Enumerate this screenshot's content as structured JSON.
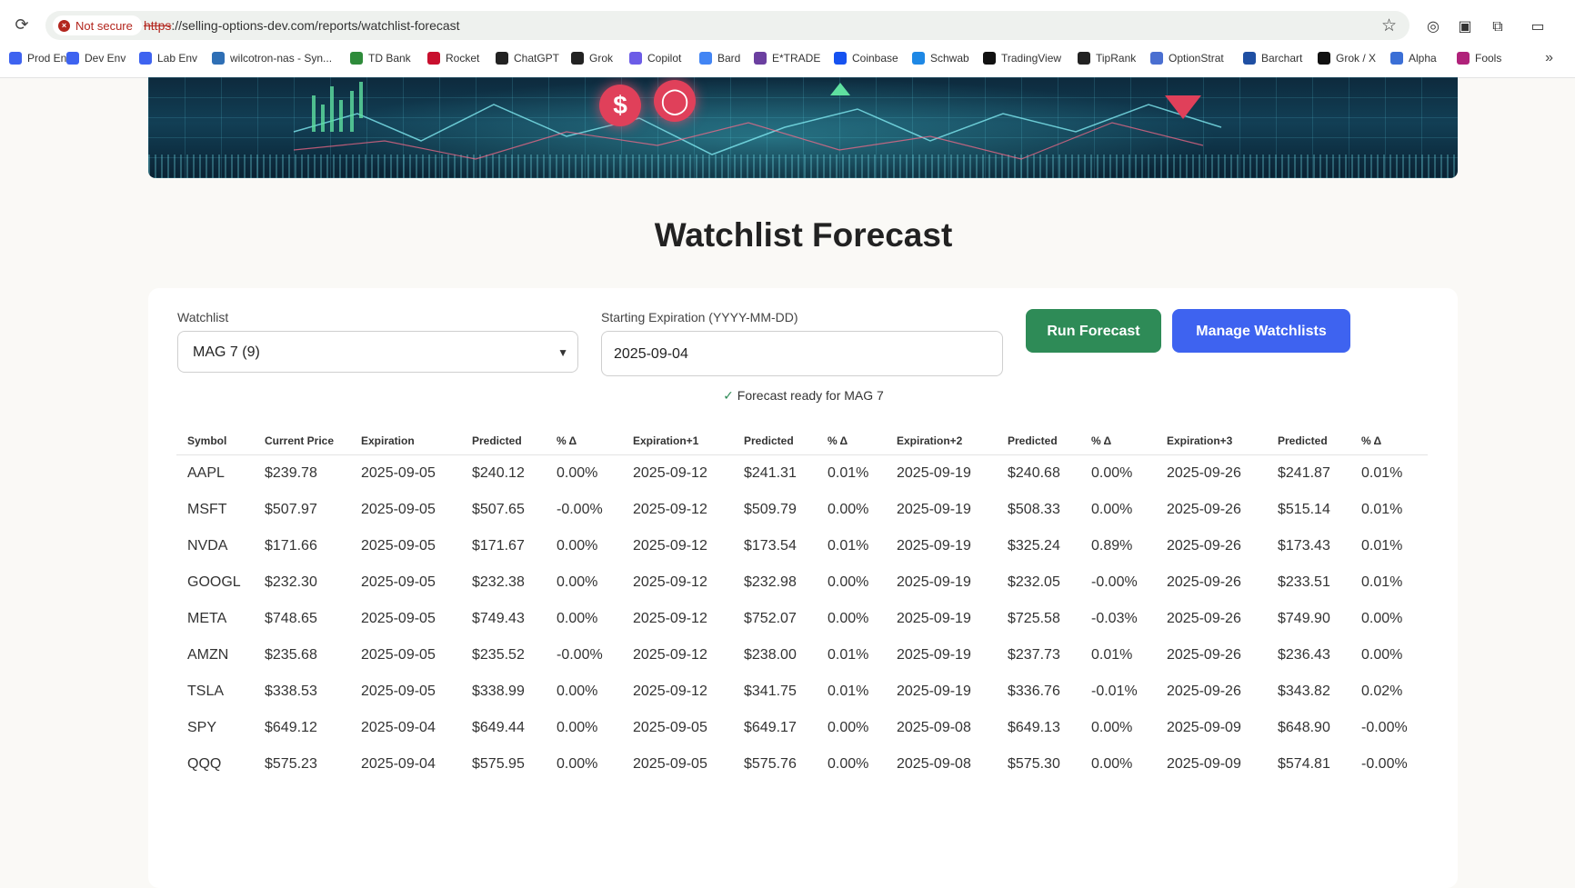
{
  "browser": {
    "security_label": "Not secure",
    "url_scheme": "https",
    "url_rest": "://selling-options-dev.com/reports/watchlist-forecast",
    "bookmarks": [
      {
        "label": "Prod Env",
        "icon": "so-icon",
        "color": "#3e63f0"
      },
      {
        "label": "Dev Env",
        "icon": "so-icon",
        "color": "#3e63f0"
      },
      {
        "label": "Lab Env",
        "icon": "so-icon",
        "color": "#3e63f0"
      },
      {
        "label": "wilcotron-nas - Syn...",
        "icon": "dsm-icon",
        "color": "#2f6fb5"
      },
      {
        "label": "TD Bank",
        "icon": "td-icon",
        "color": "#2e8b3a"
      },
      {
        "label": "Rocket",
        "icon": "rocket-icon",
        "color": "#c8102e"
      },
      {
        "label": "ChatGPT",
        "icon": "chatgpt-icon",
        "color": "#222222"
      },
      {
        "label": "Grok",
        "icon": "grok-icon",
        "color": "#222222"
      },
      {
        "label": "Copilot",
        "icon": "copilot-icon",
        "color": "#6c5ce7"
      },
      {
        "label": "Bard",
        "icon": "bard-icon",
        "color": "#4285f4"
      },
      {
        "label": "E*TRADE",
        "icon": "etrade-icon",
        "color": "#6b3fa0"
      },
      {
        "label": "Coinbase",
        "icon": "coinbase-icon",
        "color": "#1652f0"
      },
      {
        "label": "Schwab",
        "icon": "schwab-icon",
        "color": "#1e88e5"
      },
      {
        "label": "TradingView",
        "icon": "tradingview-icon",
        "color": "#111111"
      },
      {
        "label": "TipRank",
        "icon": "tipranks-icon",
        "color": "#222222"
      },
      {
        "label": "OptionStrat",
        "icon": "optionstrat-icon",
        "color": "#4a6fd1"
      },
      {
        "label": "Barchart",
        "icon": "barchart-icon",
        "color": "#1f4fa3"
      },
      {
        "label": "Grok / X",
        "icon": "x-icon",
        "color": "#111111"
      },
      {
        "label": "Alpha",
        "icon": "alpha-icon",
        "color": "#3b6fd6"
      },
      {
        "label": "Fools",
        "icon": "fools-icon",
        "color": "#b0227a"
      }
    ]
  },
  "page": {
    "title": "Watchlist Forecast",
    "watchlist_label": "Watchlist",
    "watchlist_value": "MAG 7 (9)",
    "expiration_label": "Starting Expiration (YYYY-MM-DD)",
    "expiration_value": "2025-09-04",
    "run_button": "Run Forecast",
    "manage_button": "Manage Watchlists",
    "status_check": "✓",
    "status_text": "Forecast ready for MAG 7"
  },
  "table": {
    "headers": [
      "Symbol",
      "Current Price",
      "Expiration",
      "Predicted",
      "% Δ",
      "Expiration+1",
      "Predicted",
      "% Δ",
      "Expiration+2",
      "Predicted",
      "% Δ",
      "Expiration+3",
      "Predicted",
      "% Δ"
    ],
    "rows": [
      [
        "AAPL",
        "$239.78",
        "2025-09-05",
        "$240.12",
        "0.00%",
        "2025-09-12",
        "$241.31",
        "0.01%",
        "2025-09-19",
        "$240.68",
        "0.00%",
        "2025-09-26",
        "$241.87",
        "0.01%"
      ],
      [
        "MSFT",
        "$507.97",
        "2025-09-05",
        "$507.65",
        "-0.00%",
        "2025-09-12",
        "$509.79",
        "0.00%",
        "2025-09-19",
        "$508.33",
        "0.00%",
        "2025-09-26",
        "$515.14",
        "0.01%"
      ],
      [
        "NVDA",
        "$171.66",
        "2025-09-05",
        "$171.67",
        "0.00%",
        "2025-09-12",
        "$173.54",
        "0.01%",
        "2025-09-19",
        "$325.24",
        "0.89%",
        "2025-09-26",
        "$173.43",
        "0.01%"
      ],
      [
        "GOOGL",
        "$232.30",
        "2025-09-05",
        "$232.38",
        "0.00%",
        "2025-09-12",
        "$232.98",
        "0.00%",
        "2025-09-19",
        "$232.05",
        "-0.00%",
        "2025-09-26",
        "$233.51",
        "0.01%"
      ],
      [
        "META",
        "$748.65",
        "2025-09-05",
        "$749.43",
        "0.00%",
        "2025-09-12",
        "$752.07",
        "0.00%",
        "2025-09-19",
        "$725.58",
        "-0.03%",
        "2025-09-26",
        "$749.90",
        "0.00%"
      ],
      [
        "AMZN",
        "$235.68",
        "2025-09-05",
        "$235.52",
        "-0.00%",
        "2025-09-12",
        "$238.00",
        "0.01%",
        "2025-09-19",
        "$237.73",
        "0.01%",
        "2025-09-26",
        "$236.43",
        "0.00%"
      ],
      [
        "TSLA",
        "$338.53",
        "2025-09-05",
        "$338.99",
        "0.00%",
        "2025-09-12",
        "$341.75",
        "0.01%",
        "2025-09-19",
        "$336.76",
        "-0.01%",
        "2025-09-26",
        "$343.82",
        "0.02%"
      ],
      [
        "SPY",
        "$649.12",
        "2025-09-04",
        "$649.44",
        "0.00%",
        "2025-09-05",
        "$649.17",
        "0.00%",
        "2025-09-08",
        "$649.13",
        "0.00%",
        "2025-09-09",
        "$648.90",
        "-0.00%"
      ],
      [
        "QQQ",
        "$575.23",
        "2025-09-04",
        "$575.95",
        "0.00%",
        "2025-09-05",
        "$575.76",
        "0.00%",
        "2025-09-08",
        "$575.30",
        "0.00%",
        "2025-09-09",
        "$574.81",
        "-0.00%"
      ]
    ]
  },
  "colors": {
    "run_button": "#2e8b57",
    "manage_button": "#3e63f0",
    "not_secure": "#b3261e"
  }
}
